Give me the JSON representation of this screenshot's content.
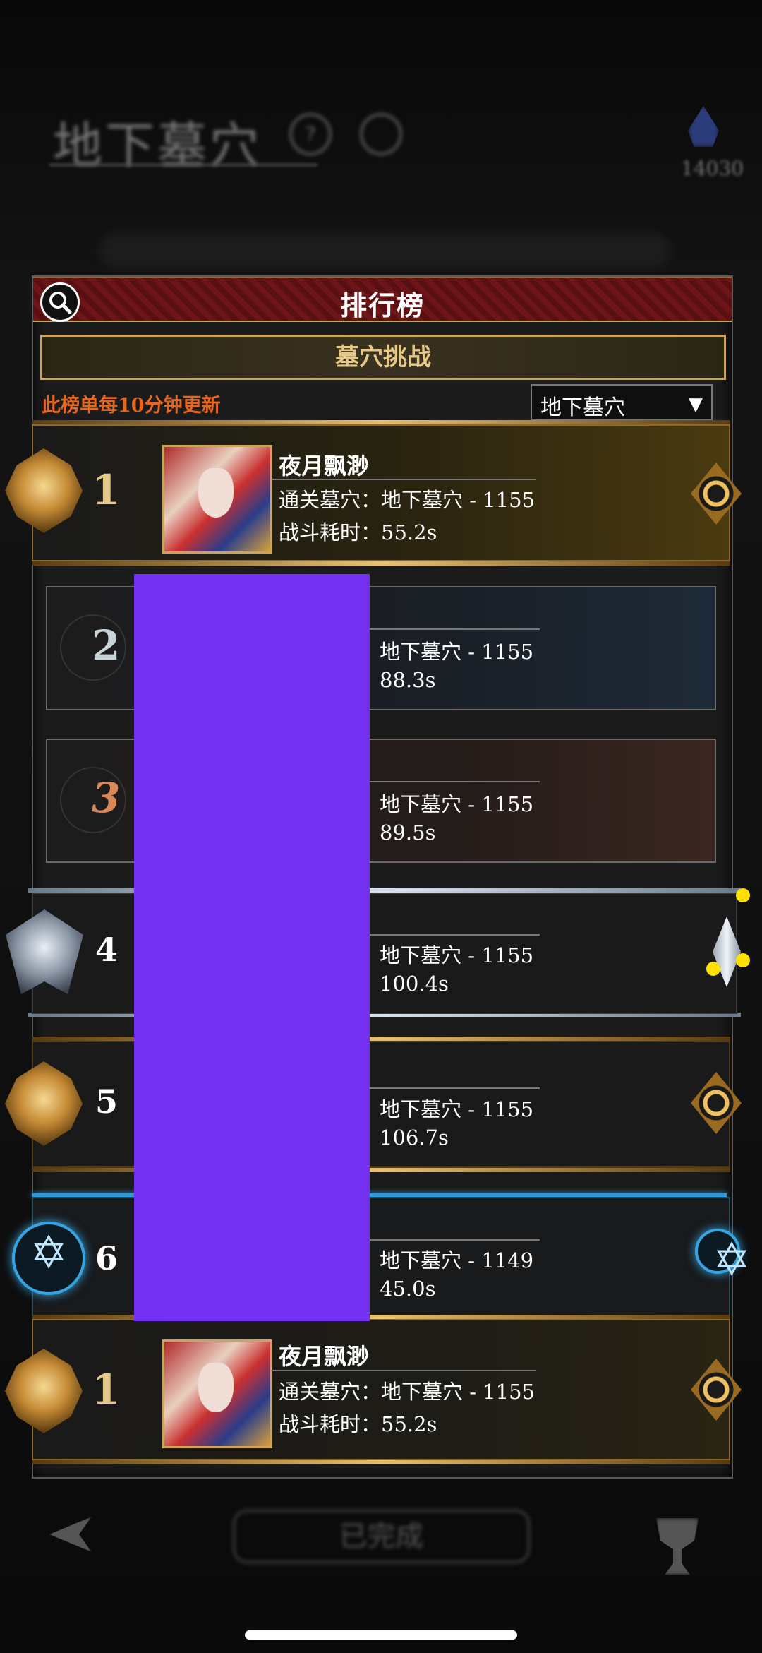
{
  "background": {
    "title": "地下墓穴",
    "gem_count": "14030",
    "bottom_button": "已完成"
  },
  "panel": {
    "title": "排行榜",
    "tab": "墓穴挑战",
    "notice": "此榜单每10分钟更新",
    "dropdown": {
      "selected": "地下墓穴",
      "arrow": "▼"
    }
  },
  "rows": [
    {
      "rank": "1",
      "name": "夜月飘渺",
      "stage": "通关墓穴：地下墓穴 - 1155",
      "time": "战斗耗时：55.2s"
    },
    {
      "rank": "2",
      "stage": "地下墓穴 - 1155",
      "time": "88.3s"
    },
    {
      "rank": "3",
      "stage": "地下墓穴 - 1155",
      "time": "89.5s"
    },
    {
      "rank": "4",
      "stage": "地下墓穴 - 1155",
      "time": "100.4s"
    },
    {
      "rank": "5",
      "stage": "地下墓穴 - 1155",
      "time": "106.7s"
    },
    {
      "rank": "6",
      "stage": "地下墓穴 - 1149",
      "time": "45.0s"
    }
  ],
  "my_rank": {
    "rank": "1",
    "name": "夜月飘渺",
    "stage": "通关墓穴：地下墓穴 - 1155",
    "time": "战斗耗时：55.2s"
  },
  "colors": {
    "accent_gold": "#c9a45a",
    "header_red": "#6e1518",
    "notice_orange": "#e5661e",
    "redaction_purple": "#7430f0"
  },
  "icons": [
    "search-icon",
    "dropdown-arrow-icon",
    "gold-rank-emblem-icon",
    "sun-emblem-icon",
    "silver-rank-emblem-icon",
    "star-emblem-icon",
    "crystal-icon",
    "back-icon",
    "trophy-icon"
  ]
}
